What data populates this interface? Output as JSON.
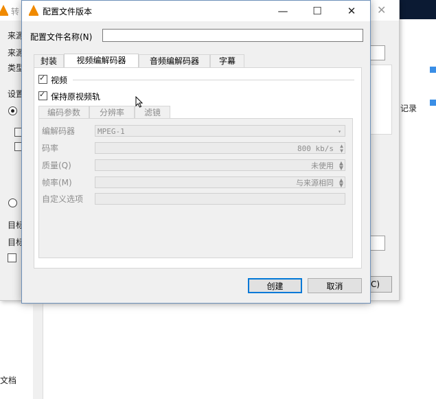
{
  "background": {
    "title_char": "转",
    "left_labels": [
      "来源",
      "来源",
      "类型",
      "设置",
      "目标",
      "目标"
    ],
    "right_text": "记录",
    "right_button_text": "C)",
    "bottom_left_text": "文档"
  },
  "dialog": {
    "title": "配置文件版本",
    "minimize_glyph": "—",
    "maximize_glyph": "☐",
    "close_glyph": "✕",
    "profile_name_label": "配置文件名称(N)",
    "profile_name_value": "",
    "tabs": [
      "封装",
      "视频编解码器",
      "音频编解码器",
      "字幕"
    ],
    "active_tab_index": 1,
    "video_checkbox_label": "视频",
    "video_checked": true,
    "keep_original_label": "保持原视频轨",
    "keep_original_checked": true,
    "subtabs": [
      "编码参数",
      "分辨率",
      "滤镜"
    ],
    "fields": {
      "codec_label": "编解码器",
      "codec_value": "MPEG-1",
      "bitrate_label": "码率",
      "bitrate_value": "800 kb/s",
      "quality_label": "质量(Q)",
      "quality_value": "未使用",
      "framerate_label": "帧率(M)",
      "framerate_value": "与来源相同",
      "custom_label": "自定义选项",
      "custom_value": ""
    },
    "create_button": "创建",
    "cancel_button": "取消"
  }
}
